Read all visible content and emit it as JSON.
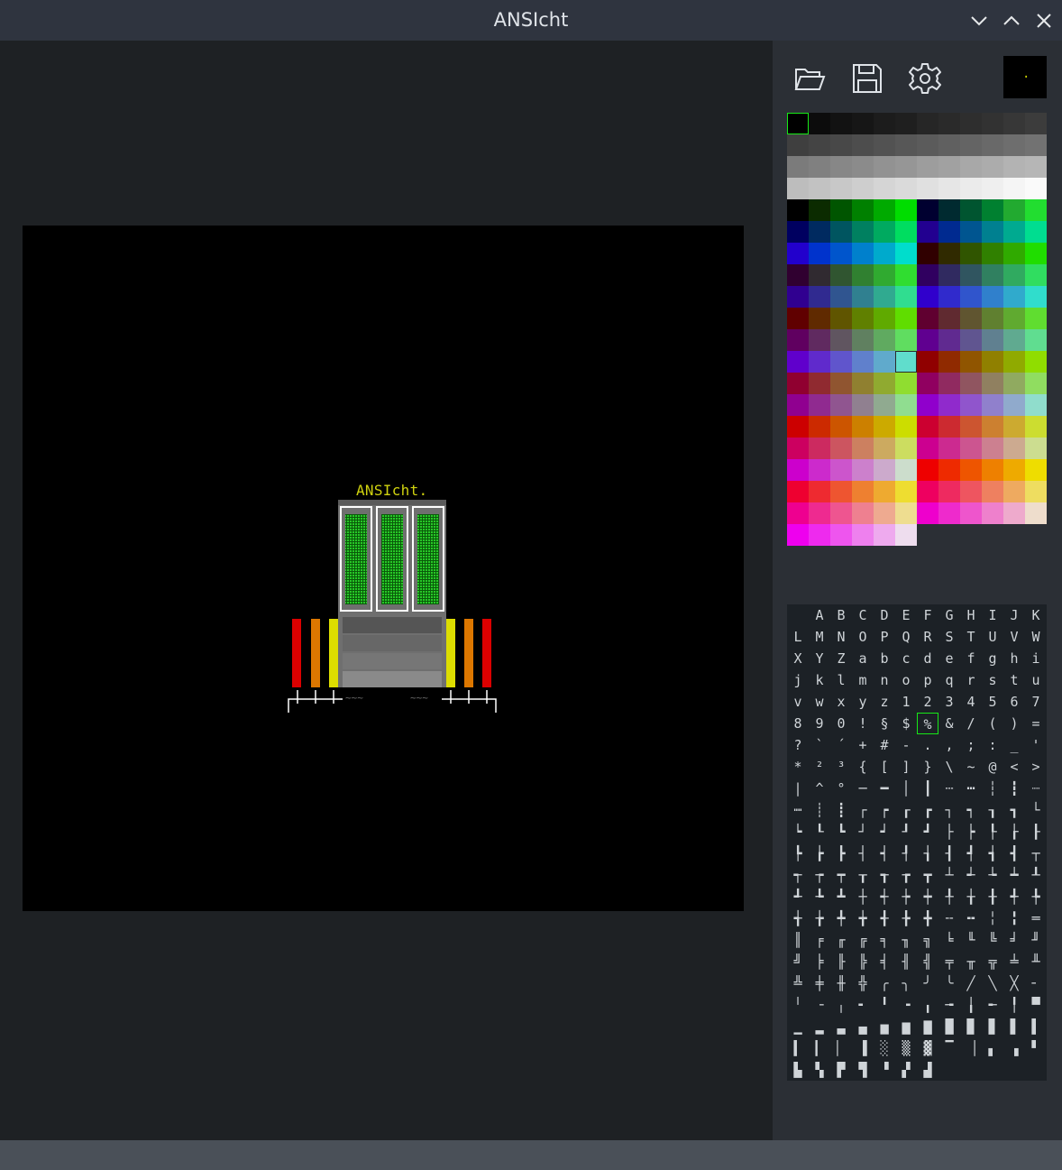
{
  "window": {
    "title": "ANSIcht",
    "controls": [
      {
        "name": "minimize-button",
        "icon": "chevron-down-icon"
      },
      {
        "name": "maximize-button",
        "icon": "chevron-up-icon"
      },
      {
        "name": "close-button",
        "icon": "close-icon"
      }
    ]
  },
  "canvas": {
    "caption": "ANSIcht.",
    "art_colors": {
      "red": "#dd0000",
      "orange": "#dd7700",
      "yellow": "#dddd00",
      "green": "#00bb00",
      "gray": "#7a7a7a",
      "white": "#ffffff"
    }
  },
  "toolbar": {
    "tools": [
      {
        "name": "open-button",
        "icon": "folder-open-icon"
      },
      {
        "name": "save-button",
        "icon": "save-icon"
      },
      {
        "name": "settings-button",
        "icon": "gear-icon"
      }
    ],
    "preview_char": ".",
    "preview_fg": "#c8d000",
    "preview_bg": "#000000"
  },
  "palette": {
    "selected_index": 0,
    "selected_fg_index": 137,
    "colors": [
      "#000000",
      "#0c0c0c",
      "#121212",
      "#161616",
      "#1c1c1c",
      "#1f1f1f",
      "#262626",
      "#2a2a2a",
      "#2e2e2e",
      "#323232",
      "#373737",
      "#3c3c3c",
      "#3f3f3f",
      "#444444",
      "#484848",
      "#4d4d4d",
      "#525252",
      "#575757",
      "#5b5b5b",
      "#606060",
      "#646464",
      "#696969",
      "#6e6e6e",
      "#727272",
      "#7b7b7b",
      "#808080",
      "#878787",
      "#8b8b8b",
      "#929292",
      "#969696",
      "#9d9d9d",
      "#a1a1a1",
      "#a8a8a8",
      "#acacac",
      "#b3b3b3",
      "#b6b6b6",
      "#bdbdbd",
      "#c2c2c2",
      "#c8c8c8",
      "#cecece",
      "#d5d5d5",
      "#dadada",
      "#e0e0e0",
      "#e6e6e6",
      "#ebebeb",
      "#efefef",
      "#f5f5f5",
      "#fafafa",
      "#000000",
      "#0b2b00",
      "#005500",
      "#008000",
      "#00aa00",
      "#00dd00",
      "#000030",
      "#002a30",
      "#005530",
      "#008030",
      "#22aa30",
      "#22dd30",
      "#000060",
      "#002a60",
      "#005560",
      "#008060",
      "#00aa60",
      "#00dd60",
      "#220090",
      "#002a90",
      "#005590",
      "#008090",
      "#00aa90",
      "#00dd90",
      "#2200cc",
      "#0033cc",
      "#0055cc",
      "#0080cc",
      "#00aacc",
      "#00ddcc",
      "#300000",
      "#302a00",
      "#305500",
      "#308000",
      "#30aa00",
      "#20dd00",
      "#300030",
      "#302a30",
      "#305530",
      "#308030",
      "#30aa30",
      "#30dd30",
      "#300060",
      "#302a60",
      "#305560",
      "#308060",
      "#30aa60",
      "#30dd60",
      "#300090",
      "#302a90",
      "#305590",
      "#308090",
      "#30aa90",
      "#30dd90",
      "#3000cc",
      "#302acc",
      "#3055cc",
      "#3080cc",
      "#30aacc",
      "#30ddcc",
      "#600000",
      "#602a00",
      "#605500",
      "#608000",
      "#60aa00",
      "#60dd00",
      "#600030",
      "#602a30",
      "#605530",
      "#608030",
      "#60aa30",
      "#60dd30",
      "#600060",
      "#602a60",
      "#605560",
      "#608060",
      "#60aa60",
      "#60dd60",
      "#600090",
      "#602a90",
      "#605590",
      "#608090",
      "#60aa90",
      "#60dd90",
      "#6000cc",
      "#602acc",
      "#6055cc",
      "#6080cc",
      "#60aacc",
      "#60ddcc",
      "#900000",
      "#902a00",
      "#905500",
      "#908000",
      "#90aa00",
      "#90dd00",
      "#900030",
      "#902a30",
      "#905530",
      "#908030",
      "#90aa30",
      "#90dd30",
      "#900060",
      "#902a60",
      "#905560",
      "#908060",
      "#90aa60",
      "#90dd60",
      "#900090",
      "#902a90",
      "#905590",
      "#908090",
      "#90aa90",
      "#90dd90",
      "#9000cc",
      "#902acc",
      "#9055cc",
      "#9080cc",
      "#90aacc",
      "#90ddcc",
      "#cc0000",
      "#cc2a00",
      "#cc5500",
      "#cc8000",
      "#ccaa00",
      "#ccdd00",
      "#cc0030",
      "#cc2a30",
      "#cc5530",
      "#cc8030",
      "#ccaa30",
      "#ccdd30",
      "#cc0060",
      "#cc2a60",
      "#cc5560",
      "#cc8060",
      "#ccaa60",
      "#ccdd60",
      "#cc0090",
      "#cc2a90",
      "#cc5590",
      "#cc8090",
      "#ccaa90",
      "#ccdd90",
      "#cc00cc",
      "#cc2acc",
      "#cc55cc",
      "#cc80cc",
      "#ccaacc",
      "#ccddcc",
      "#ee0000",
      "#ee2a00",
      "#ee5500",
      "#ee8000",
      "#eeaa00",
      "#eedd00",
      "#ee0030",
      "#ee2a30",
      "#ee5530",
      "#ee8030",
      "#eeaa30",
      "#eedd30",
      "#ee0060",
      "#ee2a60",
      "#ee5560",
      "#ee8060",
      "#eeaa60",
      "#eedd60",
      "#ee0090",
      "#ee2a90",
      "#ee5590",
      "#ee8090",
      "#eeaa90",
      "#eedd90",
      "#ee00cc",
      "#ee2acc",
      "#ee55cc",
      "#ee80cc",
      "#eeaacc",
      "#eeddcc",
      "#ee00ee",
      "#ee2aee",
      "#ee55ee",
      "#ee80ee",
      "#eeaaee",
      "#eeddee"
    ]
  },
  "charmap": {
    "selected_index": 66,
    "chars": [
      " ",
      "A",
      "B",
      "C",
      "D",
      "E",
      "F",
      "G",
      "H",
      "I",
      "J",
      "K",
      "L",
      "M",
      "N",
      "O",
      "P",
      "Q",
      "R",
      "S",
      "T",
      "U",
      "V",
      "W",
      "X",
      "Y",
      "Z",
      "a",
      "b",
      "c",
      "d",
      "e",
      "f",
      "g",
      "h",
      "i",
      "j",
      "k",
      "l",
      "m",
      "n",
      "o",
      "p",
      "q",
      "r",
      "s",
      "t",
      "u",
      "v",
      "w",
      "x",
      "y",
      "z",
      "1",
      "2",
      "3",
      "4",
      "5",
      "6",
      "7",
      "8",
      "9",
      "0",
      "!",
      "§",
      "$",
      "%",
      "&",
      "/",
      "(",
      ")",
      "=",
      "?",
      "`",
      "´",
      "+",
      "#",
      "-",
      ".",
      ",",
      ";",
      ":",
      "_",
      "'",
      "*",
      "²",
      "³",
      "{",
      "[",
      "]",
      "}",
      "\\",
      "~",
      "@",
      "<",
      ">",
      "|",
      "^",
      "°",
      "─",
      "━",
      "│",
      "┃",
      "┄",
      "┅",
      "┆",
      "┇",
      "┈",
      "┉",
      "┊",
      "┋",
      "┌",
      "┍",
      "┎",
      "┏",
      "┐",
      "┑",
      "┒",
      "┓",
      "└",
      "┕",
      "┖",
      "┗",
      "┘",
      "┙",
      "┚",
      "┛",
      "├",
      "┝",
      "┞",
      "┟",
      "┠",
      "┡",
      "┢",
      "┣",
      "┤",
      "┥",
      "┦",
      "┧",
      "┨",
      "┩",
      "┪",
      "┫",
      "┬",
      "┭",
      "┮",
      "┯",
      "┰",
      "┱",
      "┲",
      "┳",
      "┴",
      "┵",
      "┶",
      "┷",
      "┸",
      "┹",
      "┺",
      "┻",
      "┼",
      "┽",
      "┾",
      "┿",
      "╀",
      "╁",
      "╂",
      "╃",
      "╄",
      "╅",
      "╆",
      "╇",
      "╈",
      "╉",
      "╊",
      "╋",
      "╌",
      "╍",
      "╎",
      "╏",
      "═",
      "║",
      "╒",
      "╓",
      "╔",
      "╕",
      "╖",
      "╗",
      "╘",
      "╙",
      "╚",
      "╛",
      "╜",
      "╝",
      "╞",
      "╟",
      "╠",
      "╡",
      "╢",
      "╣",
      "╤",
      "╥",
      "╦",
      "╧",
      "╨",
      "╩",
      "╪",
      "╫",
      "╬",
      "╭",
      "╮",
      "╯",
      "╰",
      "╱",
      "╲",
      "╳",
      "╴",
      "╵",
      "╶",
      "╷",
      "╸",
      "╹",
      "╺",
      "╻",
      "╼",
      "╽",
      "╾",
      "╿",
      "▀",
      "▁",
      "▂",
      "▃",
      "▄",
      "▅",
      "▆",
      "▇",
      "█",
      "▉",
      "▊",
      "▋",
      "▌",
      "▍",
      "▎",
      "▏",
      "▐",
      "░",
      "▒",
      "▓",
      "▔",
      "▕",
      "▖",
      "▗",
      "▘",
      "▙",
      "▚",
      "▛",
      "▜",
      "▝",
      "▞",
      "▟"
    ]
  },
  "statusbar": {
    "text": ""
  }
}
